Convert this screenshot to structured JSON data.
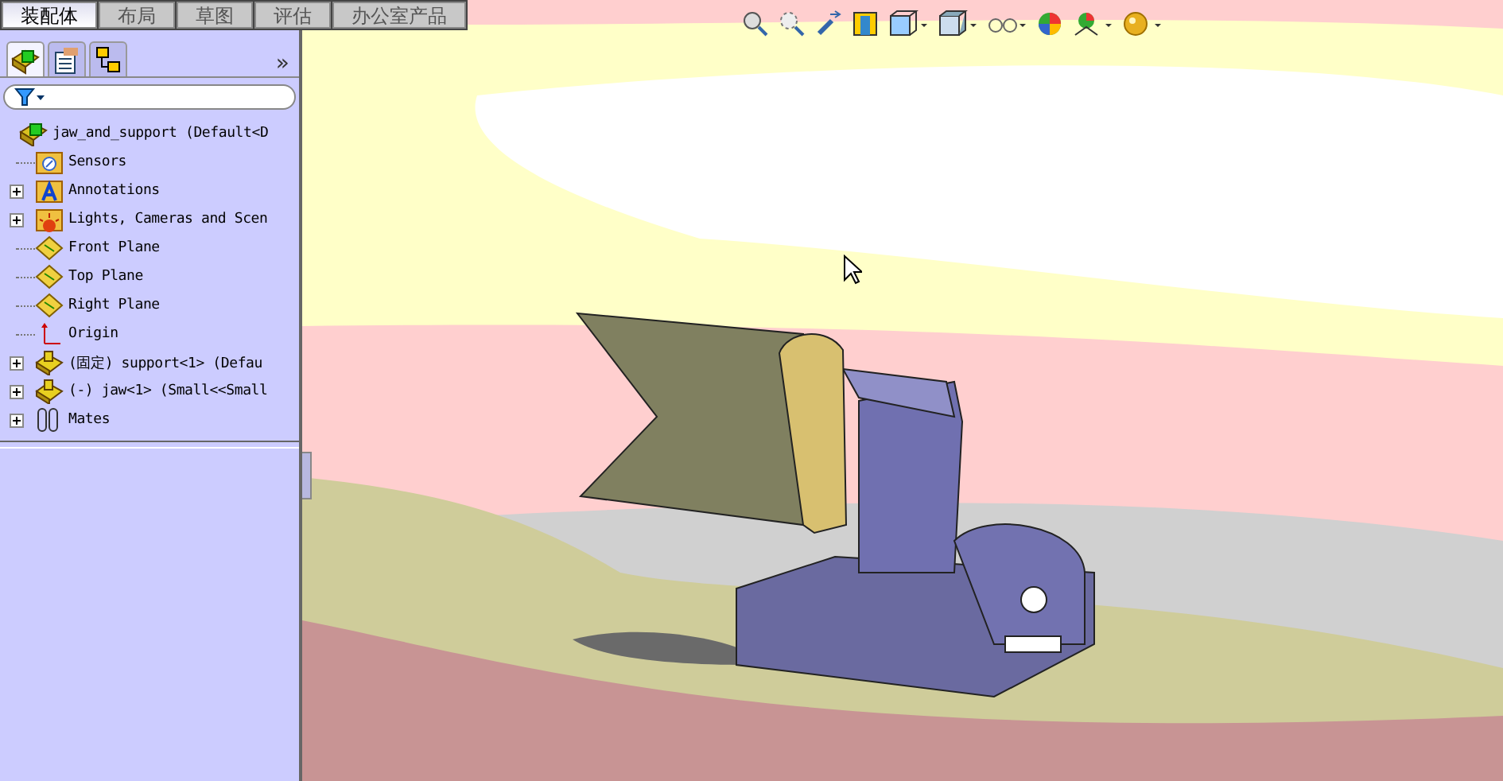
{
  "tabs": [
    {
      "label": "装配体",
      "selected": true
    },
    {
      "label": "布局",
      "selected": false
    },
    {
      "label": "草图",
      "selected": false
    },
    {
      "label": "评估",
      "selected": false
    },
    {
      "label": "办公室产品",
      "selected": false
    }
  ],
  "panel": {
    "expand_button": "»"
  },
  "tree": [
    {
      "label": "jaw_and_support  (Default<D",
      "kind": "assembly",
      "expandable": false,
      "children": [
        {
          "label": "Sensors",
          "kind": "sensors",
          "expandable": false
        },
        {
          "label": "Annotations",
          "kind": "annotations",
          "expandable": true
        },
        {
          "label": "Lights, Cameras and Scen",
          "kind": "lights",
          "expandable": true
        },
        {
          "label": "Front Plane",
          "kind": "plane",
          "expandable": false
        },
        {
          "label": "Top Plane",
          "kind": "plane",
          "expandable": false
        },
        {
          "label": "Right Plane",
          "kind": "plane",
          "expandable": false
        },
        {
          "label": "Origin",
          "kind": "origin",
          "expandable": false
        },
        {
          "label": "(固定) support<1> (Defau",
          "kind": "part",
          "expandable": true
        },
        {
          "label": "(-) jaw<1> (Small<<Small",
          "kind": "part",
          "expandable": true
        },
        {
          "label": "Mates",
          "kind": "mates",
          "expandable": true
        }
      ]
    }
  ]
}
